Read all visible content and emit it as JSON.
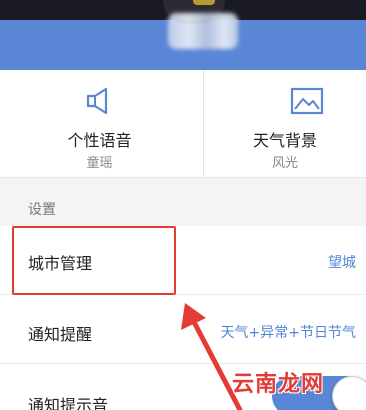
{
  "tiles": [
    {
      "icon": "speaker-icon",
      "title": "个性语音",
      "subtitle": "童瑶"
    },
    {
      "icon": "image-icon",
      "title": "天气背景",
      "subtitle": "风光"
    }
  ],
  "settings": {
    "section_title": "设置",
    "rows": [
      {
        "label": "城市管理",
        "value": "望城"
      },
      {
        "label": "通知提醒",
        "value": "天气+异常+节日节气"
      },
      {
        "label": "通知提示音",
        "toggle": "on"
      }
    ]
  },
  "watermark": "云南龙网",
  "colors": {
    "accent": "#5a86d6",
    "highlight": "#e53b35"
  }
}
